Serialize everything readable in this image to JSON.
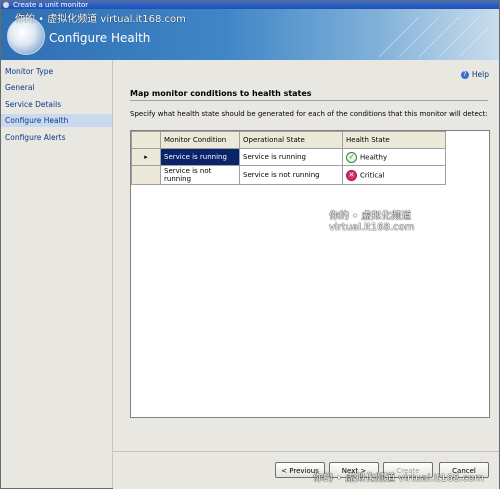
{
  "window": {
    "title": "Create a unit monitor"
  },
  "header": {
    "title": "Configure Health"
  },
  "watermark": {
    "text": "你的 • 虚拟化频道 virtual.it168.com"
  },
  "sidebar": {
    "items": [
      {
        "label": "Monitor Type"
      },
      {
        "label": "General"
      },
      {
        "label": "Service Details"
      },
      {
        "label": "Configure Health"
      },
      {
        "label": "Configure Alerts"
      }
    ]
  },
  "main": {
    "help": "Help",
    "heading": "Map monitor conditions to health states",
    "description": "Specify what health state should be generated for each of the conditions that this monitor will detect:",
    "columns": [
      "Monitor Condition",
      "Operational State",
      "Health State"
    ],
    "rows": [
      {
        "condition": "Service is running",
        "operational": "Service is running",
        "health": "Healthy",
        "icon": "healthy-check-icon"
      },
      {
        "condition": "Service is not running",
        "operational": "Service is not running",
        "health": "Critical",
        "icon": "critical-x-icon"
      }
    ]
  },
  "footer": {
    "previous": "< Previous",
    "next": "Next >",
    "create": "Create",
    "cancel": "Cancel"
  },
  "colors": {
    "selection": "#0a246a",
    "nav_selected": "#c9d9ee",
    "header": "#2f6fb3"
  }
}
